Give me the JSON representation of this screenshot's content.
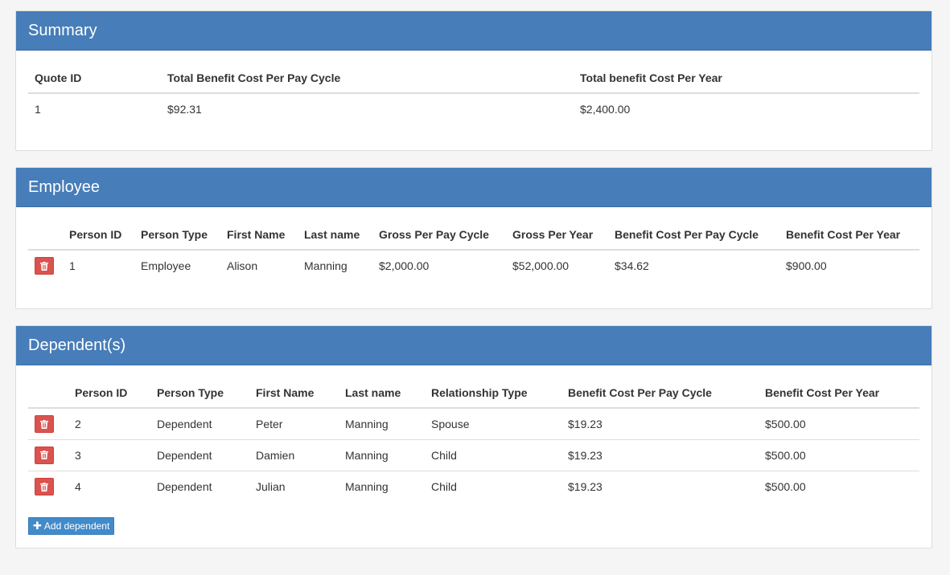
{
  "summary": {
    "title": "Summary",
    "headers": [
      "Quote ID",
      "Total Benefit Cost Per Pay Cycle",
      "Total benefit Cost Per Year"
    ],
    "row": [
      "1",
      "$92.31",
      "$2,400.00"
    ]
  },
  "employee": {
    "title": "Employee",
    "headers": [
      "Person ID",
      "Person Type",
      "First Name",
      "Last name",
      "Gross Per Pay Cycle",
      "Gross Per Year",
      "Benefit Cost Per Pay Cycle",
      "Benefit Cost Per Year"
    ],
    "rows": [
      [
        "1",
        "Employee",
        "Alison",
        "Manning",
        "$2,000.00",
        "$52,000.00",
        "$34.62",
        "$900.00"
      ]
    ]
  },
  "dependents": {
    "title": "Dependent(s)",
    "headers": [
      "Person ID",
      "Person Type",
      "First Name",
      "Last name",
      "Relationship Type",
      "Benefit Cost Per Pay Cycle",
      "Benefit Cost Per Year"
    ],
    "rows": [
      [
        "2",
        "Dependent",
        "Peter",
        "Manning",
        "Spouse",
        "$19.23",
        "$500.00"
      ],
      [
        "3",
        "Dependent",
        "Damien",
        "Manning",
        "Child",
        "$19.23",
        "$500.00"
      ],
      [
        "4",
        "Dependent",
        "Julian",
        "Manning",
        "Child",
        "$19.23",
        "$500.00"
      ]
    ],
    "add_label": "Add dependent"
  },
  "icons": {
    "delete": "trash-icon",
    "add": "plus-icon"
  },
  "colors": {
    "header": "#477db8",
    "danger": "#d9534f",
    "primary": "#428bca"
  }
}
